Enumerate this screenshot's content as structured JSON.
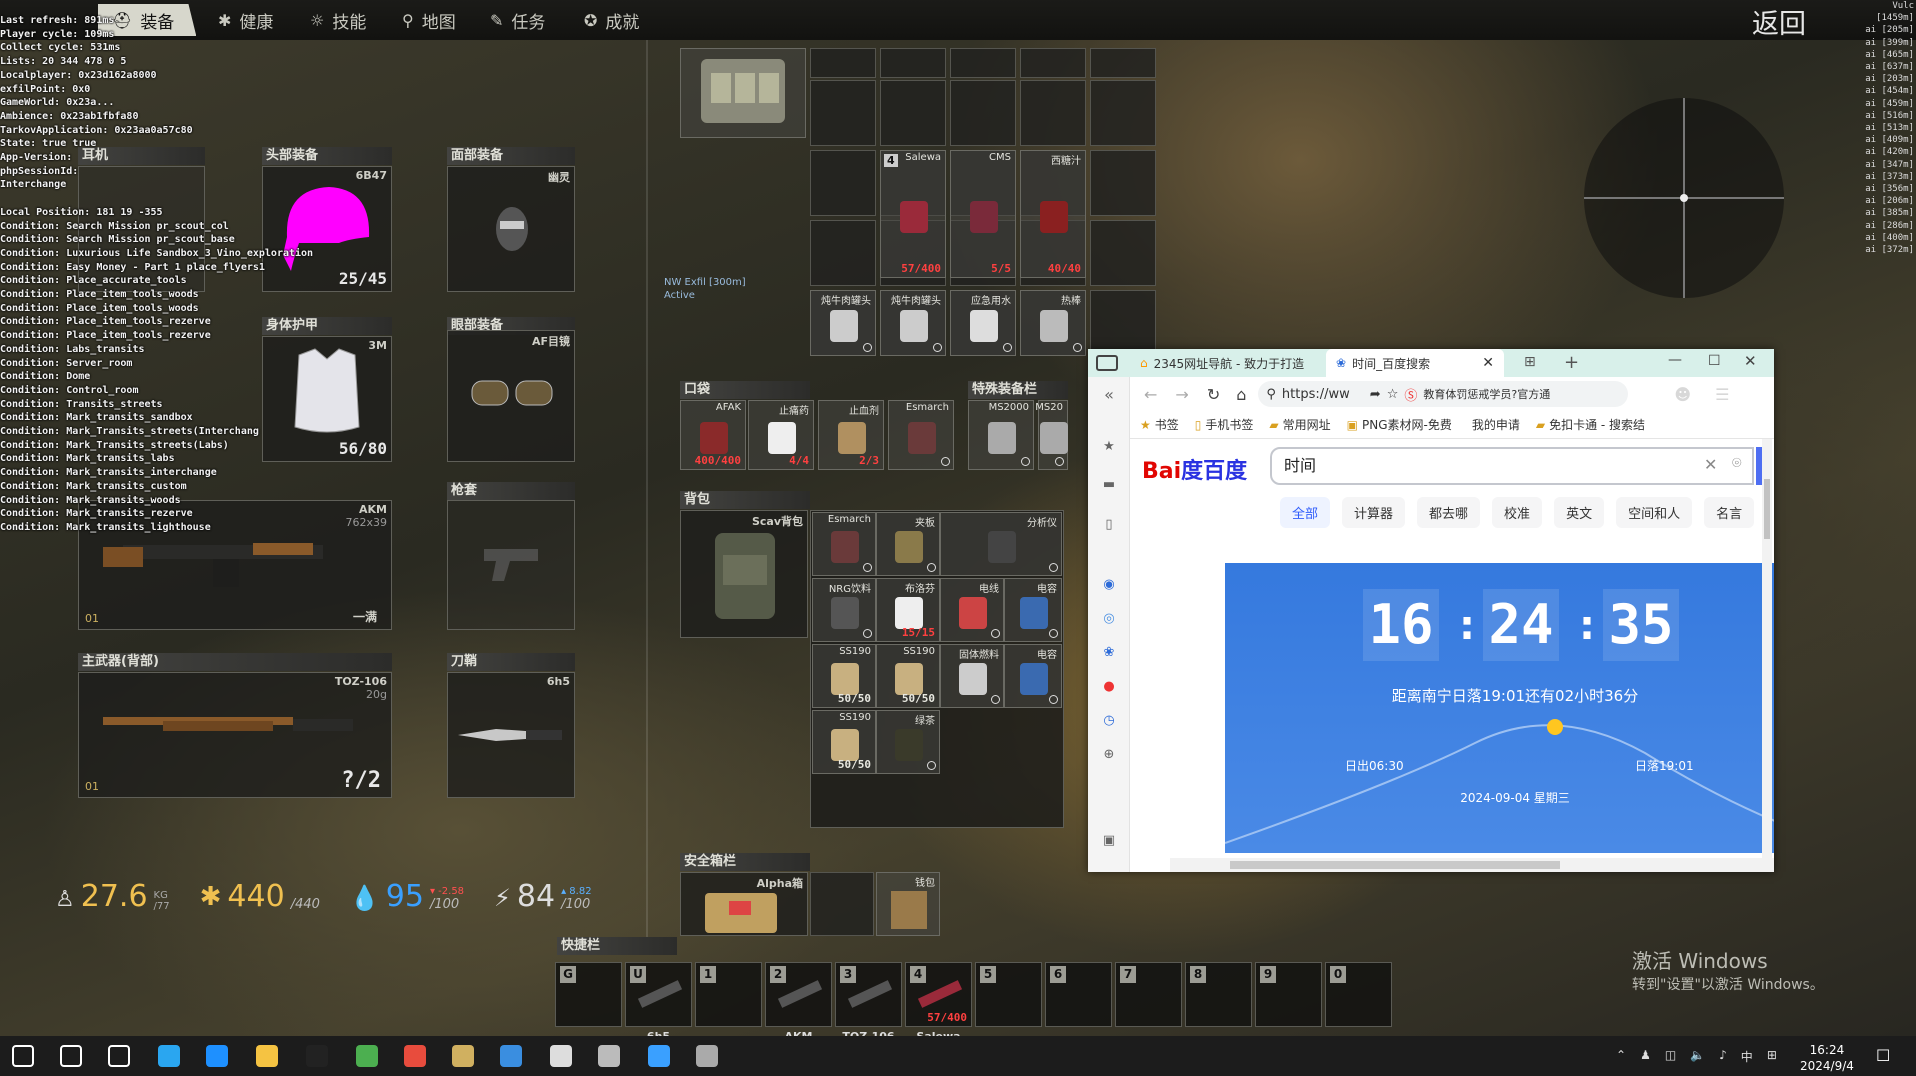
{
  "tabs": [
    {
      "label": "装备",
      "icon": "helmet-icon",
      "active": true
    },
    {
      "label": "健康",
      "icon": "health-icon"
    },
    {
      "label": "技能",
      "icon": "skills-icon"
    },
    {
      "label": "地图",
      "icon": "map-pin-icon"
    },
    {
      "label": "任务",
      "icon": "task-icon"
    },
    {
      "label": "成就",
      "icon": "achievement-icon"
    }
  ],
  "back_label": "返回",
  "debug_lines": [
    "Last refresh: 891ms",
    "Player cycle: 109ms",
    "Collect cycle: 531ms",
    "Lists: 20 344 478 0 5",
    "Localplayer: 0x23d162a8000",
    "exfilPoint: 0x0",
    "GameWorld: 0x23a...",
    "Ambience: 0x23ab1fbfa80",
    "TarkovApplication: 0x23aa0a57c80",
    "State: true true",
    "App-Version:",
    "phpSessionId:",
    "Interchange",
    "",
    "Local Position: 181 19 -355",
    "Condition: Search Mission pr_scout_col",
    "Condition: Search Mission pr_scout_base",
    "Condition: Luxurious Life Sandbox_3_Vino_exploration",
    "Condition: Easy Money - Part 1 place_flyers1",
    "Condition:  Place_accurate_tools",
    "Condition:  Place_item_tools_woods",
    "Condition:  Place_item_tools_woods",
    "Condition:  Place_item_tools_rezerve",
    "Condition:  Place_item_tools_rezerve",
    "Condition:  Labs_transits",
    "Condition:  Server_room",
    "Condition:  Dome",
    "Condition:  Control_room",
    "Condition:  Transits_streets",
    "Condition:  Mark_transits_sandbox",
    "Condition:  Mark_Transits_streets(Interchang",
    "Condition:  Mark_Transits_streets(Labs)",
    "Condition:  Mark_transits_labs",
    "Condition:  Mark_transits_interchange",
    "Condition:  Mark_transits_custom",
    "Condition:  Mark_transits_woods",
    "Condition:  Mark_transits_rezerve",
    "Condition:  Mark_transits_lighthouse"
  ],
  "equipment": {
    "earpiece": "耳机",
    "headwear": {
      "title": "头部装备",
      "code": "6B47",
      "durability": "25/45"
    },
    "face": {
      "title": "面部装备",
      "name": "幽灵"
    },
    "armor": {
      "title": "身体护甲",
      "code": "3M",
      "durability": "56/80"
    },
    "eyewear": {
      "title": "眼部装备",
      "name": "AF目镜"
    },
    "sidearm_slot": {
      "title": "AKM",
      "caliber": "762x39",
      "ammo": "一满",
      "rank": "01"
    },
    "holster": "枪套",
    "primary_back": {
      "title": "主武器(背部)",
      "name": "TOZ-106",
      "caliber": "20g",
      "ammo": "?/2",
      "rank": "01"
    },
    "scabbard": {
      "title": "刀鞘",
      "name": "6h5"
    }
  },
  "exfil": {
    "label": "NW Exfil [300m]",
    "status": "Active"
  },
  "rig_items": [
    {
      "name": "Salewa",
      "count": "57/400",
      "red": true,
      "badge": "4"
    },
    {
      "name": "CMS",
      "count": "5/5",
      "red": true
    },
    {
      "name": "西糖汁",
      "count": "40/40",
      "red": true
    },
    {
      "name": "炖牛肉罐头"
    },
    {
      "name": "炖牛肉罐头"
    },
    {
      "name": "应急用水"
    },
    {
      "name": "热棒"
    }
  ],
  "pockets": {
    "title": "口袋",
    "items": [
      {
        "name": "AFAK",
        "count": "400/400",
        "red": true
      },
      {
        "name": "止痛药",
        "count": "4/4",
        "red": true
      },
      {
        "name": "止血剂",
        "count": "2/3",
        "red": true
      },
      {
        "name": "Esmarch"
      }
    ]
  },
  "special": {
    "title": "特殊装备栏",
    "items": [
      {
        "name": "MS2000"
      },
      {
        "name": "MS20"
      }
    ]
  },
  "backpack": {
    "title": "背包",
    "bag": "Scav背包",
    "items": [
      {
        "name": "Esmarch"
      },
      {
        "name": "夹板"
      },
      {
        "name": "分析仪"
      },
      {
        "name": "NRG饮料"
      },
      {
        "name": "布洛芬",
        "count": "15/15",
        "red": true
      },
      {
        "name": "电线"
      },
      {
        "name": "电容"
      },
      {
        "name": "SS190",
        "count": "50/50"
      },
      {
        "name": "SS190",
        "count": "50/50"
      },
      {
        "name": "固体燃料"
      },
      {
        "name": "电容"
      },
      {
        "name": "SS190",
        "count": "50/50"
      },
      {
        "name": "绿茶"
      }
    ]
  },
  "secure": {
    "title": "安全箱栏",
    "name": "Alpha箱",
    "wallet": "钱包"
  },
  "quickbar": {
    "title": "快捷栏",
    "slots": [
      {
        "key": "G",
        "label": ""
      },
      {
        "key": "U",
        "label": "6h5"
      },
      {
        "key": "1",
        "label": ""
      },
      {
        "key": "2",
        "label": "AKM"
      },
      {
        "key": "3",
        "label": "TOZ-106"
      },
      {
        "key": "4",
        "label": "Salewa",
        "count": "57/400"
      },
      {
        "key": "5",
        "label": ""
      },
      {
        "key": "6",
        "label": ""
      },
      {
        "key": "7",
        "label": ""
      },
      {
        "key": "8",
        "label": ""
      },
      {
        "key": "9",
        "label": ""
      },
      {
        "key": "0",
        "label": ""
      }
    ]
  },
  "stats": {
    "weight": "27.6",
    "weight_unit": "KG",
    "weight_max": "/77",
    "energy": "440",
    "energy_max": "/440",
    "hydration": "95",
    "hydration_max": "/100",
    "hydration_delta": "▾ -2.58",
    "stamina": "84",
    "stamina_max": "/100",
    "stamina_delta": "▴ 8.82"
  },
  "side_list": [
    "Vulc [1459m]",
    "ai [205m]",
    "ai [399m]",
    "ai [465m]",
    "ai [637m]",
    "ai [203m]",
    "ai [454m]",
    "ai [459m]",
    "ai [516m]",
    "ai [513m]",
    "ai [409m]",
    "ai [420m]",
    "ai [347m]",
    "ai [373m]",
    "ai [356m]",
    "ai [206m]",
    "ai [385m]",
    "ai [286m]",
    "ai [400m]",
    "ai [372m]"
  ],
  "browser": {
    "tabs": [
      {
        "label": "2345网址导航 - 致力于打造"
      },
      {
        "label": "时间_百度搜索",
        "active": true
      }
    ],
    "address": "https://ww",
    "news": "教育体罚惩戒学员?官方通",
    "bookmarks": [
      "书签",
      "手机书签",
      "常用网址",
      "PNG素材网-免费",
      "我的申请",
      "免扣卡通 - 搜索结"
    ],
    "logo": "Bai度百度",
    "query": "时间",
    "filters": [
      "全部",
      "计算器",
      "都去哪",
      "校准",
      "英文",
      "空间和人",
      "名言"
    ],
    "time": [
      "16",
      "24",
      "35"
    ],
    "sunset_note": "距离南宁日落19:01还有02小时36分",
    "sunrise": "日出06:30",
    "sunset": "日落19:01",
    "date": "2024-09-04  星期三"
  },
  "activate": {
    "line1": "激活 Windows",
    "line2": "转到\"设置\"以激活 Windows。"
  },
  "taskbar": {
    "time": "16:24",
    "date": "2024/9/4",
    "lang": "中"
  }
}
